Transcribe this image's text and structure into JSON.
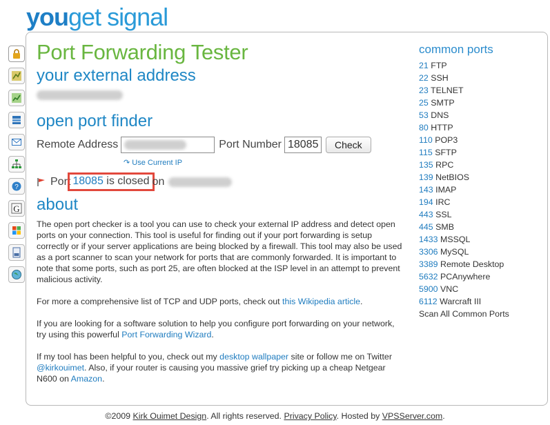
{
  "logo": {
    "part1": "you",
    "part2": "get signal"
  },
  "sidebar": {
    "items": [
      {
        "name": "lock-icon",
        "color": "#e3a51b"
      },
      {
        "name": "chart-icon",
        "color": "#8a9a2a"
      },
      {
        "name": "chart-icon",
        "color": "#3d9a3a"
      },
      {
        "name": "server-icon",
        "color": "#2f74b9"
      },
      {
        "name": "mail-icon",
        "color": "#2d75c0"
      },
      {
        "name": "network-icon",
        "color": "#2b9a3a"
      },
      {
        "name": "help-icon",
        "color": "#2f80c9"
      },
      {
        "name": "google-icon",
        "color": "#222222"
      },
      {
        "name": "windows-icon",
        "color": "#e64a19"
      },
      {
        "name": "document-icon",
        "color": "#4a6fa5"
      },
      {
        "name": "globe-icon",
        "color": "#3c9a56"
      }
    ]
  },
  "main": {
    "page_title": "Port Forwarding Tester",
    "external_heading": "your external address",
    "finder_heading": "open port finder",
    "remote_label": "Remote Address",
    "port_label": "Port Number",
    "port_value": "18085",
    "check_label": "Check",
    "use_current_ip": "Use Current IP",
    "result_prefix": "Port",
    "result_port": "18085",
    "result_status": "is closed",
    "result_on": "on",
    "about_heading": "about",
    "about_p1": "The open port checker is a tool you can use to check your external IP address and detect open ports on your connection. This tool is useful for finding out if your port forwarding is setup correctly or if your server applications are being blocked by a firewall. This tool may also be used as a port scanner to scan your network for ports that are commonly forwarded. It is important to note that some ports, such as port 25, are often blocked at the ISP level in an attempt to prevent malicious activity.",
    "about_p2_text": "For more a comprehensive list of TCP and UDP ports, check out ",
    "about_p2_link": "this Wikipedia article",
    "about_p2_end": ".",
    "about_p3_text": "If you are looking for a software solution to help you configure port forwarding on your network, try using this powerful ",
    "about_p3_link": "Port Forwarding Wizard",
    "about_p3_end": ".",
    "about_p4_text1": "If my tool has been helpful to you, check out my ",
    "about_p4_link1": "desktop wallpaper",
    "about_p4_text2": " site or follow me on Twitter ",
    "about_p4_link2": "@kirkouimet",
    "about_p4_text3": ". Also, if your router is causing you massive grief try picking up a cheap Netgear N600 on ",
    "about_p4_link3": "Amazon",
    "about_p4_end": "."
  },
  "common_ports": {
    "title": "common ports",
    "items": [
      {
        "port": "21",
        "name": "FTP"
      },
      {
        "port": "22",
        "name": "SSH"
      },
      {
        "port": "23",
        "name": "TELNET"
      },
      {
        "port": "25",
        "name": "SMTP"
      },
      {
        "port": "53",
        "name": "DNS"
      },
      {
        "port": "80",
        "name": "HTTP"
      },
      {
        "port": "110",
        "name": "POP3"
      },
      {
        "port": "115",
        "name": "SFTP"
      },
      {
        "port": "135",
        "name": "RPC"
      },
      {
        "port": "139",
        "name": "NetBIOS"
      },
      {
        "port": "143",
        "name": "IMAP"
      },
      {
        "port": "194",
        "name": "IRC"
      },
      {
        "port": "443",
        "name": "SSL"
      },
      {
        "port": "445",
        "name": "SMB"
      },
      {
        "port": "1433",
        "name": "MSSQL"
      },
      {
        "port": "3306",
        "name": "MySQL"
      },
      {
        "port": "3389",
        "name": "Remote Desktop"
      },
      {
        "port": "5632",
        "name": "PCAnywhere"
      },
      {
        "port": "5900",
        "name": "VNC"
      },
      {
        "port": "6112",
        "name": "Warcraft III"
      }
    ],
    "scan_all": "Scan All Common Ports"
  },
  "footer": {
    "copyright": "©2009 ",
    "design_link": "Kirk Ouimet Design",
    "rights": ". All rights reserved. ",
    "privacy_link": "Privacy Policy",
    "hosted": ". Hosted by ",
    "host_link": "VPSServer.com",
    "end": "."
  }
}
